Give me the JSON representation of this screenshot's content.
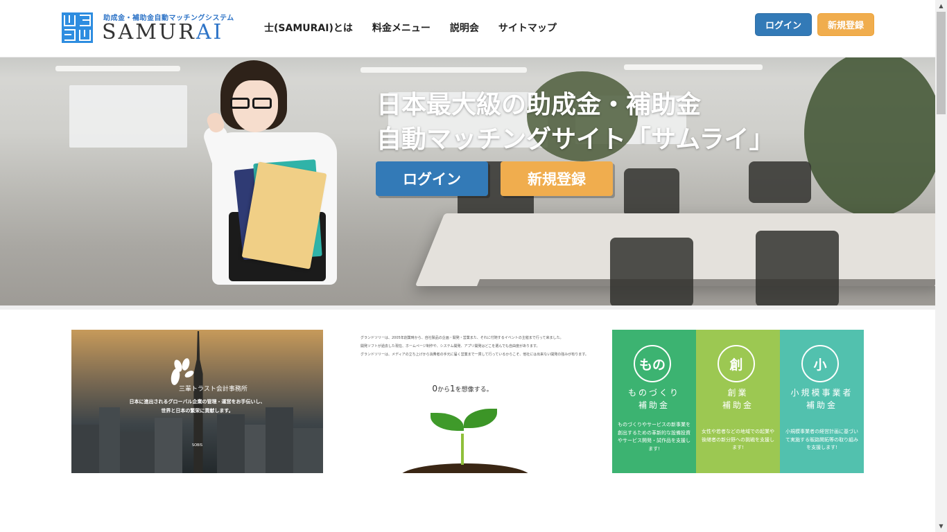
{
  "header": {
    "logo_sub": "助成金・補助金自動マッチングシステム",
    "logo_main_pre": "SAMUR",
    "logo_main_accent": "AI",
    "nav": [
      "士(SAMURAI)とは",
      "料金メニュー",
      "説明会",
      "サイトマップ"
    ],
    "login_label": "ログイン",
    "register_label": "新規登録"
  },
  "hero": {
    "title_line1": "日本最大級の助成金・補助金",
    "title_line2": "自動マッチングサイト「サムライ」",
    "login_label": "ログイン",
    "register_label": "新規登録"
  },
  "cards": {
    "card1": {
      "name": "三輩トラスト会計事務所",
      "text_line1": "日本に進出されるグローバル企業の管理・運営をお手伝いし、",
      "text_line2": "世界と日本の繁栄に貢献します。",
      "foot": "SOBIS"
    },
    "card2": {
      "para1": "グランドツリーは、2005年創業時から、自社製品の企画・開発・営業また、それに付随するイベントの主催まで行って来ました。",
      "para2": "開発ソフトが過去した現在、ホームページ制作や、システム開発、アプリ開発はどこを選んでも自由度があります。",
      "para3": "グランドツリーは、メディアの立ち上げから消費者の手元に届く営業まで一貫して行っているからこそ、他社には出来ない開発の強みが有ります。",
      "headline_a": "0",
      "headline_b": "から",
      "headline_c": "1",
      "headline_d": "を想像する。"
    },
    "card3": {
      "cols": [
        {
          "circle": "もの",
          "title1": "ものづくり",
          "title2": "補助金",
          "desc": "ものづくりやサービスの新事業を創出するための革新的な設備投資やサービス開発・試作品を支援します!"
        },
        {
          "circle": "創",
          "title1": "創業",
          "title2": "補助金",
          "desc": "女性や若者などの地域での起業や後継者の新分野への挑戦を支援します!"
        },
        {
          "circle": "小",
          "title1": "小規模事業者",
          "title2": "補助金",
          "desc": "小規模事業者の経営計画に基づいて実施する販路開拓等の取り組みを支援します!"
        }
      ]
    }
  },
  "colors": {
    "primary": "#337ab7",
    "warning": "#f0ad4e",
    "green": "#3cb371",
    "lime": "#9cc852",
    "teal": "#52c1ae"
  }
}
